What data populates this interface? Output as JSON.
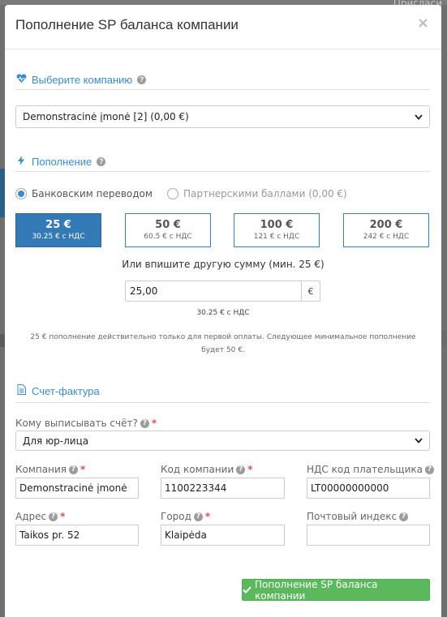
{
  "backdrop": {
    "invite_label": "Пригласи"
  },
  "modal": {
    "title": "Пополнение SP баланса компании",
    "close_symbol": "×"
  },
  "company_section": {
    "title": "Выберите компанию",
    "icon": "heartbeat-icon",
    "selected": "Demonstracinė įmonė [2] (0,00 €)"
  },
  "topup_section": {
    "title": "Пополнение",
    "icon": "bolt-icon",
    "methods": [
      {
        "label": "Банковским переводом",
        "selected": true
      },
      {
        "label": "Партнерскими баллами (0,00 €)",
        "selected": false
      }
    ],
    "amounts": [
      {
        "value": "25 €",
        "vat": "30.25 € с НДС",
        "selected": true
      },
      {
        "value": "50 €",
        "vat": "60.5 € с НДС",
        "selected": false
      },
      {
        "value": "100 €",
        "vat": "121 € с НДС",
        "selected": false
      },
      {
        "value": "200 €",
        "vat": "242 € с НДС",
        "selected": false
      }
    ],
    "custom_prompt": "Или впишите другую сумму (мин. 25 €)",
    "custom_value": "25,00",
    "currency": "€",
    "custom_vat": "30.25 € с НДС",
    "note": "25 € пополнение действительно только для первой оплаты. Следующее минимальное пополнение будет 50 €."
  },
  "invoice_section": {
    "title": "Счет-фактура",
    "icon": "document-icon",
    "recipient_label": "Кому выписывать счёт?",
    "recipient_value": "Для юр-лица",
    "company_label": "Компания",
    "company_value": "Demonstracinė įmonė",
    "company_code_label": "Код компании",
    "company_code_value": "1100223344",
    "vat_code_label": "НДС код плательщика",
    "vat_code_value": "LT00000000000",
    "address_label": "Адрес",
    "address_value": "Taikos pr. 52",
    "city_label": "Город",
    "city_value": "Klaipėda",
    "postal_label": "Почтовый индекс",
    "postal_value": ""
  },
  "submit": {
    "label": "Пополнение SP баланса компании",
    "icon": "check-icon"
  },
  "colors": {
    "accent": "#3a8bd0",
    "selected_amount": "#337ab7",
    "submit": "#5cb85c",
    "required": "#d9534f"
  }
}
